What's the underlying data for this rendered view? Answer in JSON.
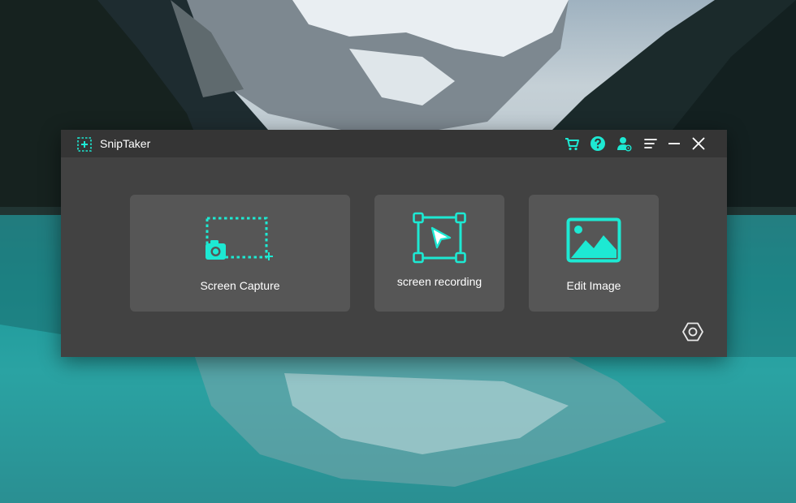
{
  "window": {
    "title": "SnipTaker",
    "logo_icon": "sniptaker-logo-icon",
    "titlebar_icons": [
      "cart-icon",
      "help-icon",
      "account-icon",
      "menu-icon",
      "minimize-icon",
      "close-icon"
    ]
  },
  "cards": [
    {
      "label": "Screen Capture",
      "icon": "screen-capture-icon"
    },
    {
      "label": "screen recording",
      "icon": "screen-recording-icon"
    },
    {
      "label": "Edit Image",
      "icon": "edit-image-icon"
    }
  ],
  "footer": {
    "settings_icon": "settings-icon"
  },
  "colors": {
    "accent": "#1de9d3",
    "window_bg": "#424242",
    "titlebar_bg": "#353535",
    "card_bg": "#565656",
    "text": "#ffffff"
  }
}
